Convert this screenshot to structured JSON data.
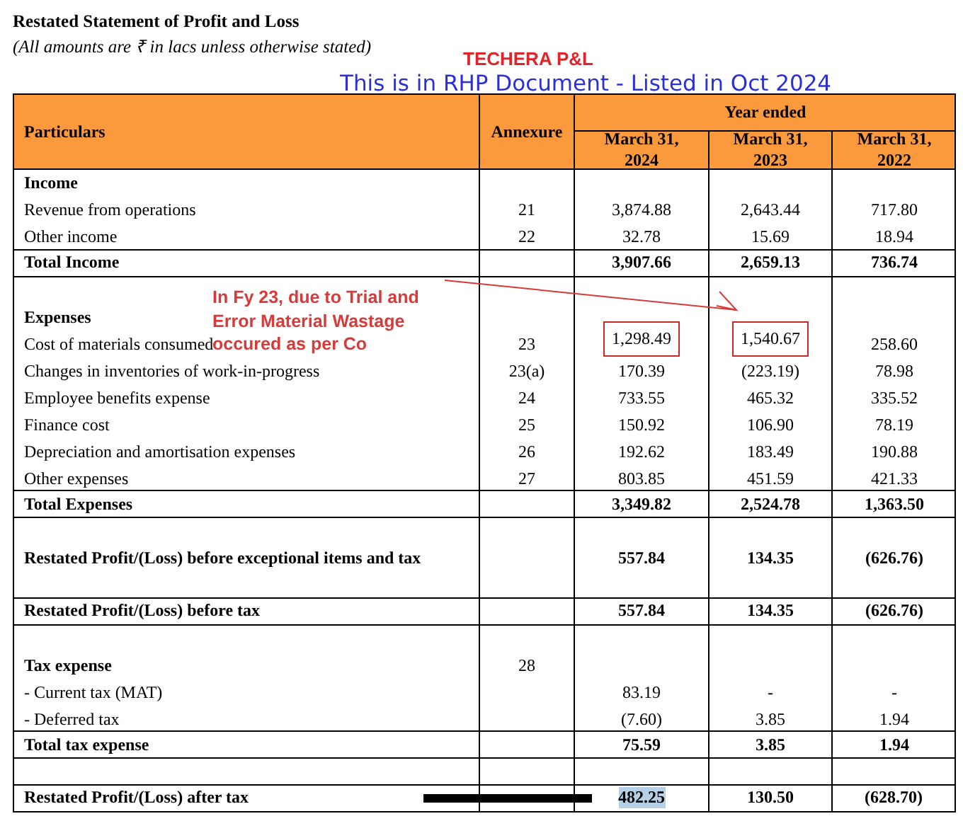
{
  "document": {
    "title": "Restated Statement of Profit and Loss",
    "subtitle": "(All amounts are ₹ in lacs unless otherwise stated)",
    "overlay_title": "TECHERA P&L",
    "overlay_note": "This is in RHP Document - Listed in Oct 2024"
  },
  "table": {
    "columns": {
      "particulars": "Particulars",
      "annexure": "Annexure",
      "group": "Year ended",
      "years": [
        "March 31, 2024",
        "March 31, 2023",
        "March 31, 2022"
      ]
    },
    "rows": [
      {
        "kind": "heading",
        "label": "Income"
      },
      {
        "kind": "item",
        "label": "Revenue from operations",
        "annexure": "21",
        "values": [
          "3,874.88",
          "2,643.44",
          "717.80"
        ]
      },
      {
        "kind": "item",
        "label": "Other income",
        "annexure": "22",
        "values": [
          "32.78",
          "15.69",
          "18.94"
        ]
      },
      {
        "kind": "total",
        "label": "Total Income",
        "values": [
          "3,907.66",
          "2,659.13",
          "736.74"
        ]
      },
      {
        "kind": "blank"
      },
      {
        "kind": "heading",
        "label": "Expenses"
      },
      {
        "kind": "item",
        "label": "Cost of materials consumed",
        "annexure": "23",
        "values": [
          {
            "text": "1,298.49",
            "boxed": true
          },
          {
            "text": "1,540.67",
            "boxed": true
          },
          {
            "text": "258.60",
            "boxed": false
          }
        ]
      },
      {
        "kind": "item",
        "label": "Changes in inventories of work-in-progress",
        "annexure": "23(a)",
        "values": [
          "170.39",
          "(223.19)",
          "78.98"
        ]
      },
      {
        "kind": "item",
        "label": "Employee benefits expense",
        "annexure": "24",
        "values": [
          "733.55",
          "465.32",
          "335.52"
        ]
      },
      {
        "kind": "item",
        "label": "Finance cost",
        "annexure": "25",
        "values": [
          "150.92",
          "106.90",
          "78.19"
        ]
      },
      {
        "kind": "item",
        "label": "Depreciation and amortisation expenses",
        "annexure": "26",
        "values": [
          "192.62",
          "183.49",
          "190.88"
        ]
      },
      {
        "kind": "item",
        "label": "Other expenses",
        "annexure": "27",
        "values": [
          "803.85",
          "451.59",
          "421.33"
        ]
      },
      {
        "kind": "total",
        "label": "Total Expenses",
        "values": [
          "3,349.82",
          "2,524.78",
          "1,363.50"
        ]
      },
      {
        "kind": "blank"
      },
      {
        "kind": "subtotal",
        "label": "Restated Profit/(Loss) before exceptional items and tax",
        "values": [
          "557.84",
          "134.35",
          "(626.76)"
        ]
      },
      {
        "kind": "blank"
      },
      {
        "kind": "total",
        "label": "Restated Profit/(Loss) before tax",
        "values": [
          "557.84",
          "134.35",
          "(626.76)"
        ]
      },
      {
        "kind": "blank"
      },
      {
        "kind": "heading",
        "label": "Tax expense",
        "annexure": "28"
      },
      {
        "kind": "item",
        "label": "- Current tax (MAT)",
        "values": [
          "83.19",
          "-",
          "-"
        ]
      },
      {
        "kind": "item",
        "label": "- Deferred tax",
        "values": [
          "(7.60)",
          "3.85",
          "1.94"
        ]
      },
      {
        "kind": "total",
        "label": "Total tax expense",
        "values": [
          "75.59",
          "3.85",
          "1.94"
        ]
      },
      {
        "kind": "blank"
      },
      {
        "kind": "total",
        "label": "Restated Profit/(Loss) after tax",
        "redacted": true,
        "values": [
          {
            "text": "482.25",
            "highlighted": true
          },
          {
            "text": "130.50",
            "highlighted": false
          },
          {
            "text": "(628.70)",
            "highlighted": false
          }
        ]
      }
    ]
  },
  "annotation": {
    "text_lines": [
      "In Fy 23, due to Trial and",
      "Error Material Wastage",
      "occured as per Co"
    ]
  }
}
